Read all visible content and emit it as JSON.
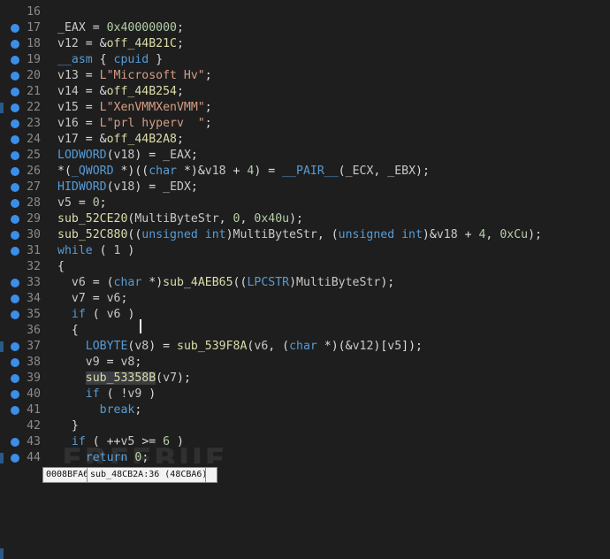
{
  "lines": [
    {
      "n": "16",
      "dot": false,
      "tokens": []
    },
    {
      "n": "17",
      "dot": true,
      "tokens": [
        [
          "c-var",
          "_EAX"
        ],
        [
          "c-op",
          " = "
        ],
        [
          "c-num",
          "0x40000000"
        ],
        [
          "c-op",
          ";"
        ]
      ]
    },
    {
      "n": "18",
      "dot": true,
      "tokens": [
        [
          "c-var",
          "v12"
        ],
        [
          "c-op",
          " = &"
        ],
        [
          "c-id",
          "off_44B21C"
        ],
        [
          "c-op",
          ";"
        ]
      ]
    },
    {
      "n": "19",
      "dot": true,
      "tokens": [
        [
          "c-kw",
          "__asm"
        ],
        [
          "c-op",
          " { "
        ],
        [
          "c-kw",
          "cpuid"
        ],
        [
          "c-op",
          " }"
        ]
      ]
    },
    {
      "n": "20",
      "dot": true,
      "tokens": [
        [
          "c-var",
          "v13"
        ],
        [
          "c-op",
          " = "
        ],
        [
          "c-str",
          "L\"Microsoft Hv\""
        ],
        [
          "c-op",
          ";"
        ]
      ]
    },
    {
      "n": "21",
      "dot": true,
      "tokens": [
        [
          "c-var",
          "v14"
        ],
        [
          "c-op",
          " = &"
        ],
        [
          "c-id",
          "off_44B254"
        ],
        [
          "c-op",
          ";"
        ]
      ]
    },
    {
      "n": "22",
      "dot": true,
      "tokens": [
        [
          "c-var",
          "v15"
        ],
        [
          "c-op",
          " = "
        ],
        [
          "c-str",
          "L\"XenVMMXenVMM\""
        ],
        [
          "c-op",
          ";"
        ]
      ]
    },
    {
      "n": "23",
      "dot": true,
      "tokens": [
        [
          "c-var",
          "v16"
        ],
        [
          "c-op",
          " = "
        ],
        [
          "c-str",
          "L\"prl hyperv  \""
        ],
        [
          "c-op",
          ";"
        ]
      ]
    },
    {
      "n": "24",
      "dot": true,
      "tokens": [
        [
          "c-var",
          "v17"
        ],
        [
          "c-op",
          " = &"
        ],
        [
          "c-id",
          "off_44B2A8"
        ],
        [
          "c-op",
          ";"
        ]
      ]
    },
    {
      "n": "25",
      "dot": true,
      "tokens": [
        [
          "c-kw",
          "LODWORD"
        ],
        [
          "c-op",
          "("
        ],
        [
          "c-var",
          "v18"
        ],
        [
          "c-op",
          ") = "
        ],
        [
          "c-var",
          "_EAX"
        ],
        [
          "c-op",
          ";"
        ]
      ]
    },
    {
      "n": "26",
      "dot": true,
      "tokens": [
        [
          "c-op",
          "*("
        ],
        [
          "c-kw",
          "_QWORD"
        ],
        [
          "c-op",
          " *)(("
        ],
        [
          "c-kw",
          "char"
        ],
        [
          "c-op",
          " *)&"
        ],
        [
          "c-var",
          "v18"
        ],
        [
          "c-op",
          " + "
        ],
        [
          "c-num",
          "4"
        ],
        [
          "c-op",
          ") = "
        ],
        [
          "c-kw",
          "__PAIR__"
        ],
        [
          "c-op",
          "("
        ],
        [
          "c-var",
          "_ECX"
        ],
        [
          "c-op",
          ", "
        ],
        [
          "c-var",
          "_EBX"
        ],
        [
          "c-op",
          ");"
        ]
      ]
    },
    {
      "n": "27",
      "dot": true,
      "tokens": [
        [
          "c-kw",
          "HIDWORD"
        ],
        [
          "c-op",
          "("
        ],
        [
          "c-var",
          "v18"
        ],
        [
          "c-op",
          ") = "
        ],
        [
          "c-var",
          "_EDX"
        ],
        [
          "c-op",
          ";"
        ]
      ]
    },
    {
      "n": "28",
      "dot": true,
      "tokens": [
        [
          "c-var",
          "v5"
        ],
        [
          "c-op",
          " = "
        ],
        [
          "c-num",
          "0"
        ],
        [
          "c-op",
          ";"
        ]
      ]
    },
    {
      "n": "29",
      "dot": true,
      "tokens": [
        [
          "c-id",
          "sub_52CE20"
        ],
        [
          "c-op",
          "("
        ],
        [
          "c-var",
          "MultiByteStr"
        ],
        [
          "c-op",
          ", "
        ],
        [
          "c-num",
          "0"
        ],
        [
          "c-op",
          ", "
        ],
        [
          "c-num",
          "0x40u"
        ],
        [
          "c-op",
          ");"
        ]
      ]
    },
    {
      "n": "30",
      "dot": true,
      "tokens": [
        [
          "c-id",
          "sub_52C880"
        ],
        [
          "c-op",
          "(("
        ],
        [
          "c-kw",
          "unsigned int"
        ],
        [
          "c-op",
          ")"
        ],
        [
          "c-var",
          "MultiByteStr"
        ],
        [
          "c-op",
          ", ("
        ],
        [
          "c-kw",
          "unsigned int"
        ],
        [
          "c-op",
          ")&"
        ],
        [
          "c-var",
          "v18"
        ],
        [
          "c-op",
          " + "
        ],
        [
          "c-num",
          "4"
        ],
        [
          "c-op",
          ", "
        ],
        [
          "c-num",
          "0xCu"
        ],
        [
          "c-op",
          ");"
        ]
      ]
    },
    {
      "n": "31",
      "dot": true,
      "tokens": [
        [
          "c-kw",
          "while"
        ],
        [
          "c-op",
          " ( "
        ],
        [
          "c-num",
          "1"
        ],
        [
          "c-op",
          " )"
        ]
      ]
    },
    {
      "n": "32",
      "dot": false,
      "tokens": [
        [
          "c-op",
          "{"
        ]
      ]
    },
    {
      "n": "33",
      "dot": true,
      "tokens": [
        [
          "c-op",
          "  "
        ],
        [
          "c-var",
          "v6"
        ],
        [
          "c-op",
          " = ("
        ],
        [
          "c-kw",
          "char"
        ],
        [
          "c-op",
          " *)"
        ],
        [
          "c-id",
          "sub_4AEB65"
        ],
        [
          "c-op",
          "(("
        ],
        [
          "c-kw",
          "LPCSTR"
        ],
        [
          "c-op",
          ")"
        ],
        [
          "c-var",
          "MultiByteStr"
        ],
        [
          "c-op",
          ");"
        ]
      ]
    },
    {
      "n": "34",
      "dot": true,
      "tokens": [
        [
          "c-op",
          "  "
        ],
        [
          "c-var",
          "v7"
        ],
        [
          "c-op",
          " = "
        ],
        [
          "c-var",
          "v6"
        ],
        [
          "c-op",
          ";"
        ]
      ]
    },
    {
      "n": "35",
      "dot": true,
      "tokens": [
        [
          "c-op",
          "  "
        ],
        [
          "c-kw",
          "if"
        ],
        [
          "c-op",
          " ( "
        ],
        [
          "c-var",
          "v6"
        ],
        [
          "c-op",
          " )"
        ]
      ]
    },
    {
      "n": "36",
      "dot": false,
      "tokens": [
        [
          "c-op",
          "  {"
        ]
      ]
    },
    {
      "n": "37",
      "dot": true,
      "tokens": [
        [
          "c-op",
          "    "
        ],
        [
          "c-kw",
          "LOBYTE"
        ],
        [
          "c-op",
          "("
        ],
        [
          "c-var",
          "v8"
        ],
        [
          "c-op",
          ") = "
        ],
        [
          "c-id",
          "sub_539F8A"
        ],
        [
          "c-op",
          "("
        ],
        [
          "c-var",
          "v6"
        ],
        [
          "c-op",
          ", ("
        ],
        [
          "c-kw",
          "char"
        ],
        [
          "c-op",
          " *)(&"
        ],
        [
          "c-var",
          "v12"
        ],
        [
          "c-op",
          ")["
        ],
        [
          "c-var",
          "v5"
        ],
        [
          "c-op",
          "]);"
        ]
      ]
    },
    {
      "n": "38",
      "dot": true,
      "tokens": [
        [
          "c-op",
          "    "
        ],
        [
          "c-var",
          "v9"
        ],
        [
          "c-op",
          " = "
        ],
        [
          "c-var",
          "v8"
        ],
        [
          "c-op",
          ";"
        ]
      ]
    },
    {
      "n": "39",
      "dot": true,
      "tokens": [
        [
          "c-op",
          "    "
        ],
        [
          "c-id hl",
          "sub_53358B"
        ],
        [
          "c-op",
          "("
        ],
        [
          "c-var",
          "v7"
        ],
        [
          "c-op",
          ");"
        ]
      ]
    },
    {
      "n": "40",
      "dot": true,
      "tokens": [
        [
          "c-op",
          "    "
        ],
        [
          "c-kw",
          "if"
        ],
        [
          "c-op",
          " ( !"
        ],
        [
          "c-var",
          "v9"
        ],
        [
          "c-op",
          " )"
        ]
      ]
    },
    {
      "n": "41",
      "dot": true,
      "tokens": [
        [
          "c-op",
          "      "
        ],
        [
          "c-kw",
          "break"
        ],
        [
          "c-op",
          ";"
        ]
      ]
    },
    {
      "n": "42",
      "dot": false,
      "tokens": [
        [
          "c-op",
          "  }"
        ]
      ]
    },
    {
      "n": "43",
      "dot": true,
      "tokens": [
        [
          "c-op",
          "  "
        ],
        [
          "c-kw",
          "if"
        ],
        [
          "c-op",
          " ( ++"
        ],
        [
          "c-var",
          "v5"
        ],
        [
          "c-op",
          " >= "
        ],
        [
          "c-num",
          "6"
        ],
        [
          "c-op",
          " )"
        ]
      ]
    },
    {
      "n": "44",
      "dot": true,
      "tokens": [
        [
          "c-op",
          "    "
        ],
        [
          "c-kw",
          "return"
        ],
        [
          "c-op",
          " "
        ],
        [
          "c-num",
          "0"
        ],
        [
          "c-op",
          ";"
        ]
      ]
    }
  ],
  "status": {
    "address": "0008BFA6",
    "location": "sub_48CB2A:36 (48CBA6)",
    "extra": ""
  },
  "watermark": "FREEBUF"
}
